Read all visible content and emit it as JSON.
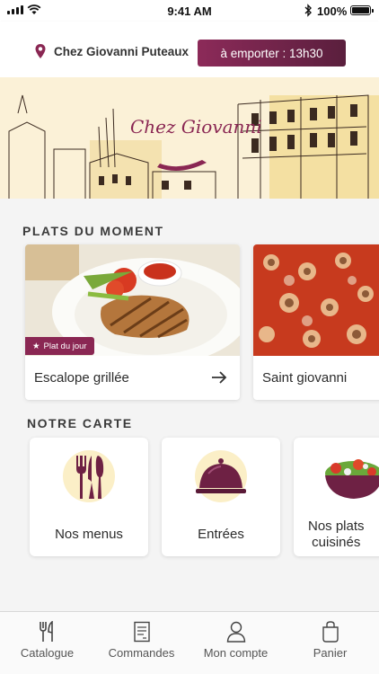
{
  "status_bar": {
    "time": "9:41 AM",
    "battery": "100%"
  },
  "header": {
    "location": "Chez Giovanni Puteaux",
    "takeaway_button": "à emporter : 13h30",
    "accent": "#8a2753"
  },
  "banner": {
    "logo_text": "Chez Giovanni"
  },
  "plats": {
    "title": "PLATS DU MOMENT",
    "items": [
      {
        "name": "Escalope grillée",
        "badge": "Plat du jour",
        "image": "grilled-escalope-photo"
      },
      {
        "name": "Saint giovanni",
        "image": "pizza-photo"
      }
    ]
  },
  "carte": {
    "title": "NOTRE CARTE",
    "items": [
      {
        "label": "Nos menus",
        "icon": "cutlery-icon"
      },
      {
        "label": "Entrées",
        "icon": "cloche-icon"
      },
      {
        "label_line1": "Nos plats",
        "label_line2": "cuisinés",
        "icon": "salad-bowl-icon"
      }
    ]
  },
  "tabs": [
    {
      "label": "Catalogue",
      "icon": "fork-knife-icon"
    },
    {
      "label": "Commandes",
      "icon": "receipt-icon"
    },
    {
      "label": "Mon compte",
      "icon": "user-icon"
    },
    {
      "label": "Panier",
      "icon": "bag-icon"
    }
  ]
}
